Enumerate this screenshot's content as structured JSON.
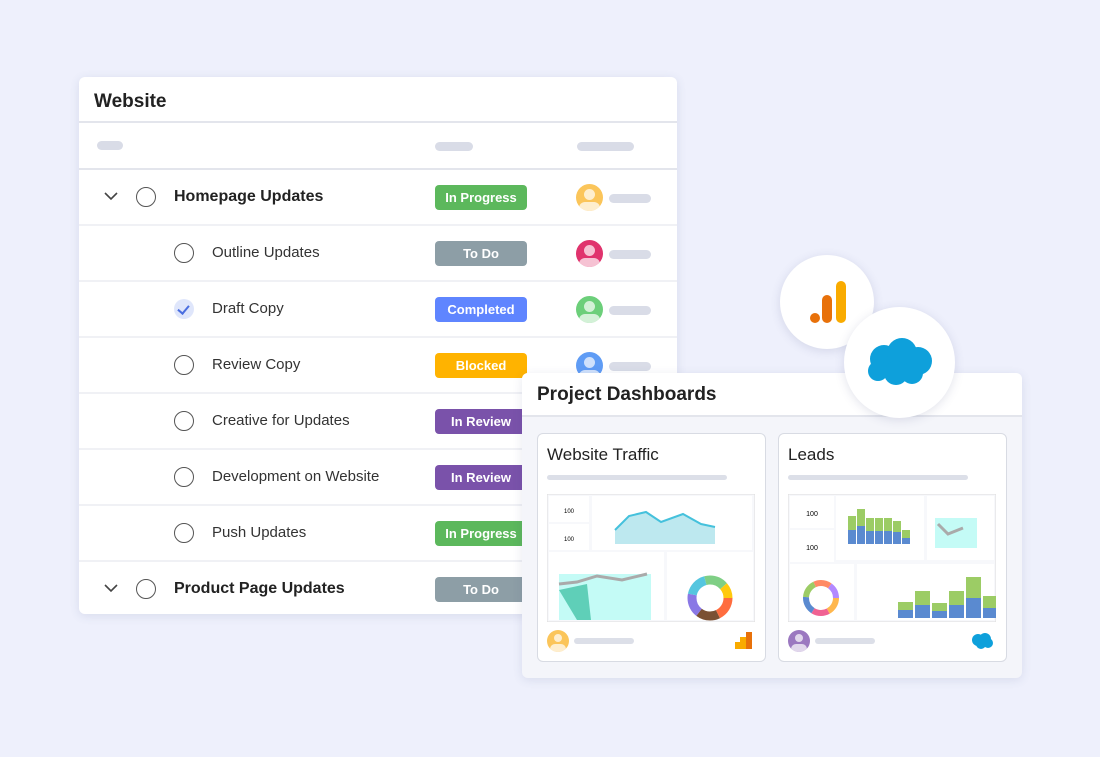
{
  "website": {
    "title": "Website",
    "rows": [
      {
        "name": "Homepage Updates",
        "group": true,
        "done": false,
        "status": "In Progress",
        "status_color": "#5cb85c",
        "avatar_color": "#fbc55a"
      },
      {
        "name": "Outline Updates",
        "group": false,
        "done": false,
        "status": "To Do",
        "status_color": "#8d9ea6",
        "avatar_color": "#e0336d"
      },
      {
        "name": "Draft Copy",
        "group": false,
        "done": true,
        "status": "Completed",
        "status_color": "#5f85ff",
        "avatar_color": "#6ccf7a"
      },
      {
        "name": "Review Copy",
        "group": false,
        "done": false,
        "status": "Blocked",
        "status_color": "#ffb300",
        "avatar_color": "#5f9cf5"
      },
      {
        "name": "Creative for Updates",
        "group": false,
        "done": false,
        "status": "In Review",
        "status_color": "#7a52aa",
        "avatar_color": "#9aa3ad"
      },
      {
        "name": "Development on Website",
        "group": false,
        "done": false,
        "status": "In Review",
        "status_color": "#7a52aa",
        "avatar_color": "#9aa3ad"
      },
      {
        "name": "Push Updates",
        "group": false,
        "done": false,
        "status": "In Progress",
        "status_color": "#5cb85c",
        "avatar_color": "#9aa3ad"
      },
      {
        "name": "Product Page Updates",
        "group": true,
        "done": false,
        "status": "To Do",
        "status_color": "#8d9ea6",
        "avatar_color": "#9aa3ad"
      }
    ]
  },
  "dashboards": {
    "title": "Project Dashboards",
    "cards": [
      {
        "title": "Website Traffic",
        "metric1": "100",
        "metric2": "100",
        "avatar_color": "#fbc55a",
        "integration": "google-analytics-icon"
      },
      {
        "title": "Leads",
        "metric1": "100",
        "metric2": "100",
        "avatar_color": "#9b78c0",
        "integration": "salesforce-icon"
      }
    ]
  },
  "integrations": [
    "google-analytics-icon",
    "salesforce-icon"
  ]
}
